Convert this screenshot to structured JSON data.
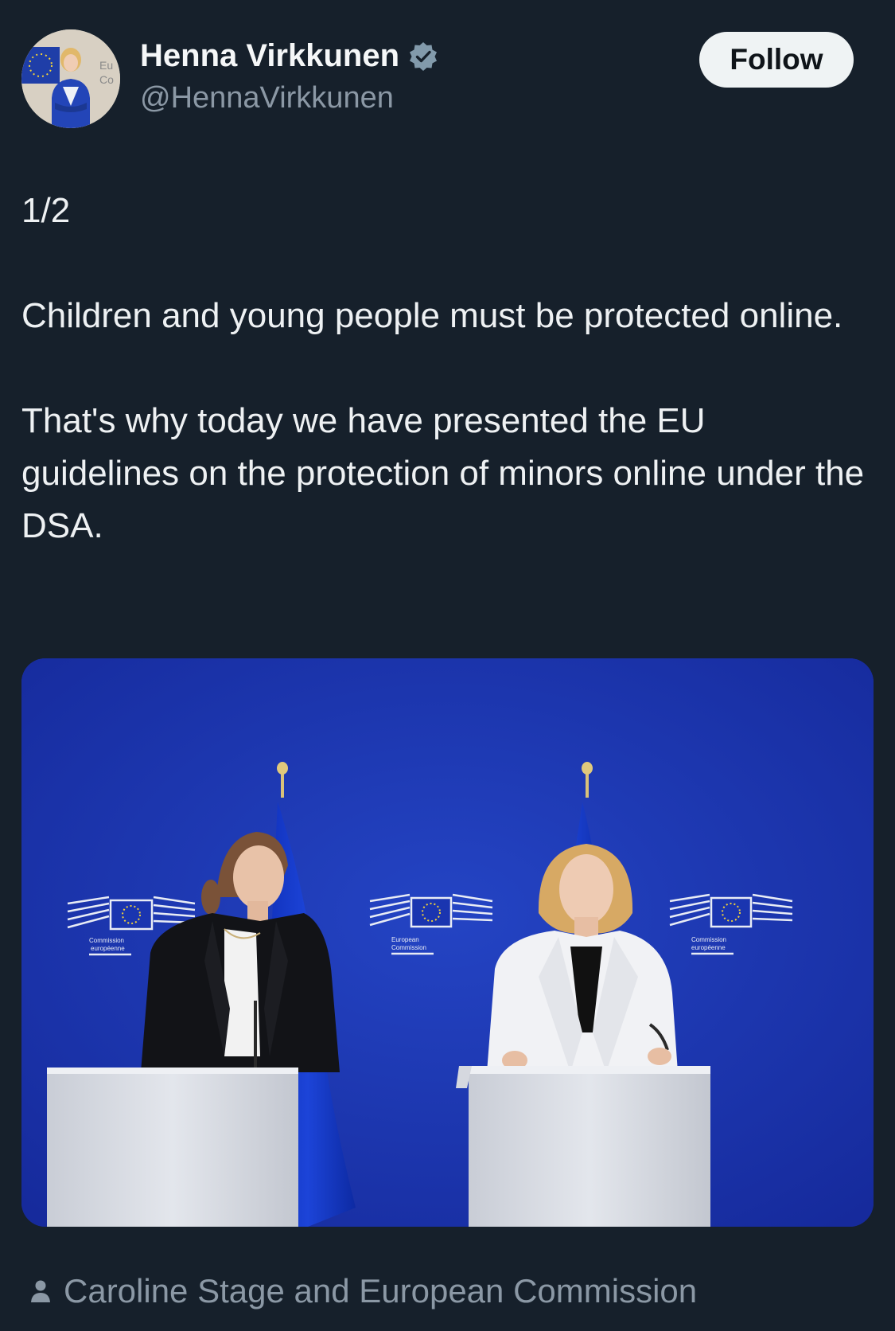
{
  "author": {
    "name": "Henna Virkkunen",
    "handle": "@HennaVirkkunen",
    "verified_icon": "verified-badge-icon",
    "avatar_badge_text": [
      "Eu",
      "Co"
    ]
  },
  "follow_button": {
    "label": "Follow"
  },
  "tweet": {
    "paragraphs": [
      "1/2",
      "Children and young people must be protected online.",
      "That's why today we have presented the EU guidelines on the protection of minors online under the DSA."
    ]
  },
  "media": {
    "backdrop_labels": {
      "left": [
        "Commission",
        "européenne"
      ],
      "center": [
        "European",
        "Commission"
      ],
      "right": [
        "Commission",
        "européenne"
      ]
    }
  },
  "tagged": {
    "icon": "person-icon",
    "text": "Caroline Stage and European Commission"
  },
  "colors": {
    "background": "#16202b",
    "follow_bg": "#eff3f4",
    "secondary_text": "#8b98a5",
    "verified": "#829aab",
    "eu_blue": "#1a2e9e"
  }
}
